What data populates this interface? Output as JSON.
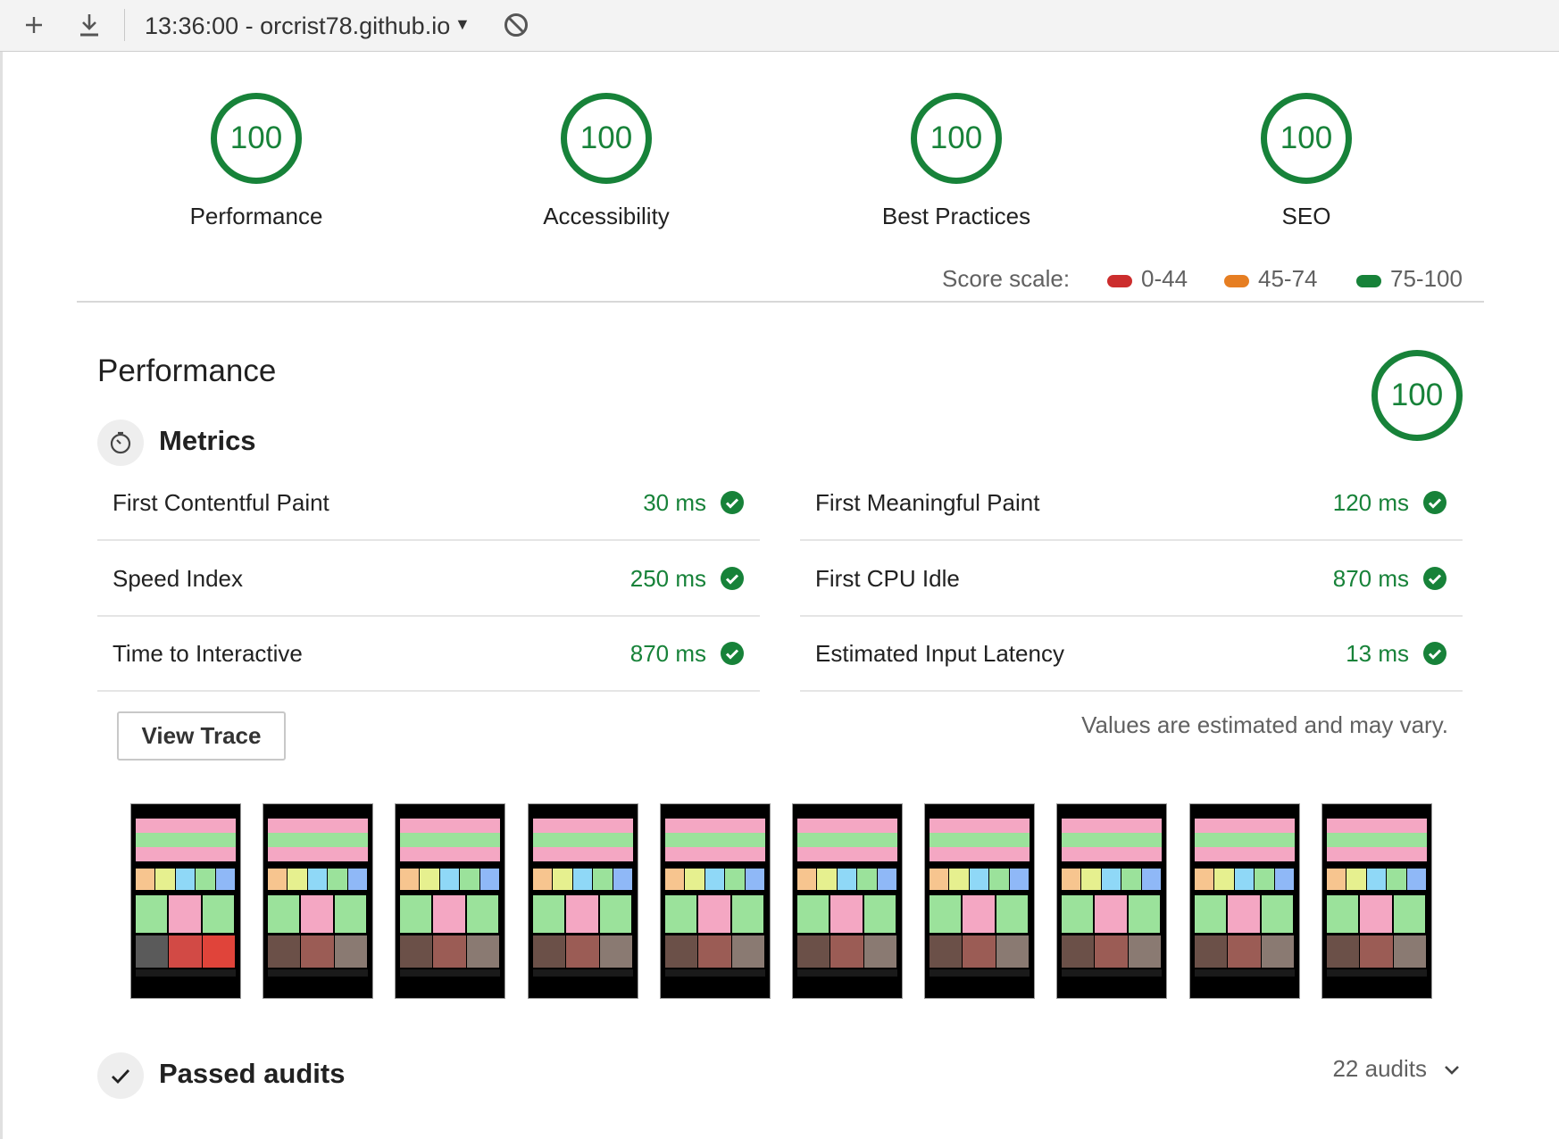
{
  "toolbar": {
    "title": "13:36:00 - orcrist78.github.io",
    "icons": [
      "plus-icon",
      "download-icon",
      "caret-down-icon",
      "block-icon"
    ]
  },
  "categories": [
    {
      "score": "100",
      "label": "Performance"
    },
    {
      "score": "100",
      "label": "Accessibility"
    },
    {
      "score": "100",
      "label": "Best Practices"
    },
    {
      "score": "100",
      "label": "SEO"
    }
  ],
  "score_scale": {
    "label": "Score scale:",
    "ranges": [
      {
        "range": "0-44",
        "color": "#cc2d2d"
      },
      {
        "range": "45-74",
        "color": "#e67e22"
      },
      {
        "range": "75-100",
        "color": "#178239"
      }
    ]
  },
  "performance": {
    "title": "Performance",
    "score": "100",
    "metrics_label": "Metrics",
    "metrics": [
      {
        "name": "First Contentful Paint",
        "value": "30 ms"
      },
      {
        "name": "First Meaningful Paint",
        "value": "120 ms"
      },
      {
        "name": "Speed Index",
        "value": "250 ms"
      },
      {
        "name": "First CPU Idle",
        "value": "870 ms"
      },
      {
        "name": "Time to Interactive",
        "value": "870 ms"
      },
      {
        "name": "Estimated Input Latency",
        "value": "13 ms"
      }
    ],
    "view_trace_label": "View Trace",
    "estimate_note": "Values are estimated and may vary.",
    "filmstrip_frames": 10
  },
  "passed_audits": {
    "label": "Passed audits",
    "count": "22 audits"
  },
  "colors": {
    "pass_green": "#178239",
    "text": "#212121",
    "muted": "#616161"
  }
}
